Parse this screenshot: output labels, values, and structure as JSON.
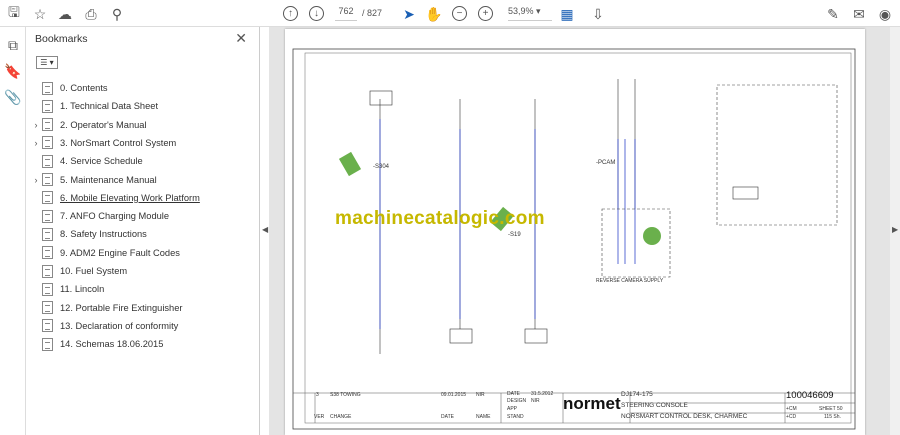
{
  "toolbar": {
    "page_current": "762",
    "page_total": "/ 827",
    "zoom": "53,9%"
  },
  "bookmarks": {
    "title": "Bookmarks",
    "options": "☰ ▾",
    "items": [
      {
        "label": "0. Contents",
        "expandable": false
      },
      {
        "label": "1. Technical Data Sheet",
        "expandable": false
      },
      {
        "label": "2. Operator's Manual",
        "expandable": true
      },
      {
        "label": "3. NorSmart Control System",
        "expandable": true
      },
      {
        "label": "4. Service Schedule",
        "expandable": false
      },
      {
        "label": "5. Maintenance Manual",
        "expandable": true
      },
      {
        "label": "6. Mobile Elevating Work Platform",
        "expandable": false,
        "selected": true
      },
      {
        "label": "7. ANFO Charging Module",
        "expandable": false
      },
      {
        "label": "8. Safety Instructions",
        "expandable": false
      },
      {
        "label": "9. ADM2 Engine Fault Codes",
        "expandable": false
      },
      {
        "label": "10. Fuel System",
        "expandable": false
      },
      {
        "label": "11. Lincoln",
        "expandable": false
      },
      {
        "label": "12. Portable Fire Extinguisher",
        "expandable": false
      },
      {
        "label": "13. Declaration of conformity",
        "expandable": false
      },
      {
        "label": "14. Schemas 18.06.2015",
        "expandable": false
      }
    ]
  },
  "document": {
    "watermark": "machinecatalogic.com",
    "labels": {
      "s304": "-S304",
      "s19": "-S19",
      "pcam": "-PCAM",
      "camera": "REVERSE CAMERA SUPPLY"
    },
    "titleblock": {
      "ver": "3",
      "change": "S38 TOWING",
      "change_date": "09.01.2015",
      "change_name": "NIR",
      "date_label": "DATE",
      "date": "31.5.2012",
      "design_label": "DESIGN",
      "design": "NIR",
      "app_label": "APP",
      "stand_label": "STAND",
      "ver_label": "VER",
      "change_label": "CHANGE",
      "col_date": "DATE",
      "col_name": "NAME",
      "logo": "normet",
      "model": "DJ174-175",
      "doc_title": "STEERING CONSOLE",
      "doc_sub": "NORSMART CONTROL DESK, CHARMEC",
      "doc_number": "100046609",
      "cm": "+CM",
      "cd": "+CD",
      "sheet": "SHEET 50",
      "sheet_of": "115 Sh."
    }
  }
}
